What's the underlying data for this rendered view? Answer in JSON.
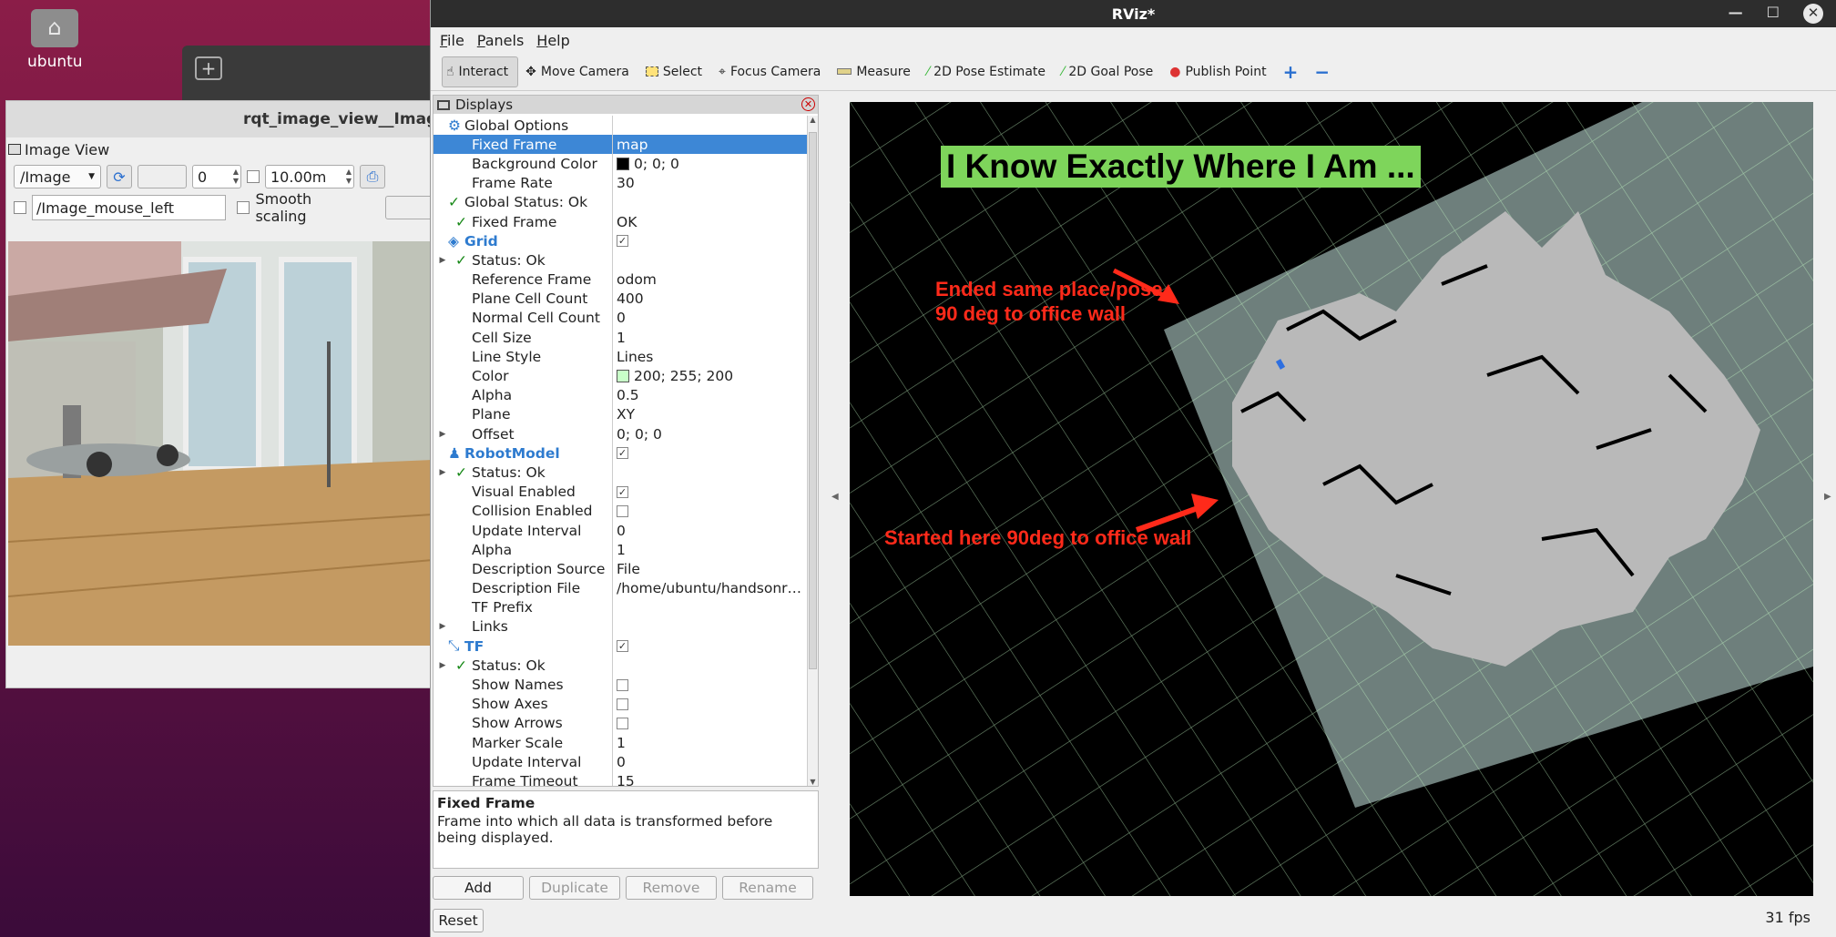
{
  "desktop": {
    "icon_label": "ubuntu"
  },
  "rqt": {
    "title": "rqt_image_view__ImageVi",
    "panel_title": "Image View",
    "topic": "/Image",
    "spin_value": "0",
    "max_range": "10.00m",
    "mouse_topic": "/Image_mouse_left",
    "smooth_scaling_label": "Smooth scaling"
  },
  "rviz": {
    "title": "RViz*",
    "menu": [
      "File",
      "Panels",
      "Help"
    ],
    "tools": {
      "interact": "Interact",
      "move_camera": "Move Camera",
      "select": "Select",
      "focus_camera": "Focus Camera",
      "measure": "Measure",
      "pose_estimate": "2D Pose Estimate",
      "goal_pose": "2D Goal Pose",
      "publish_point": "Publish Point"
    },
    "displays": {
      "title": "Displays",
      "rows": [
        {
          "name": "Global Options",
          "value": "",
          "indent": 0,
          "icon": "gear"
        },
        {
          "name": "Fixed Frame",
          "value": "map",
          "indent": 1,
          "selected": true
        },
        {
          "name": "Background Color",
          "value": "0; 0; 0",
          "indent": 1,
          "swatch": "#000000"
        },
        {
          "name": "Frame Rate",
          "value": "30",
          "indent": 1
        },
        {
          "name": "Global Status: Ok",
          "value": "",
          "indent": 0,
          "check": true
        },
        {
          "name": "Fixed Frame",
          "value": "OK",
          "indent": 1,
          "check": true
        },
        {
          "name": "Grid",
          "value": "",
          "indent": 0,
          "bold": true,
          "cb": true,
          "icon": "grid"
        },
        {
          "name": "Status: Ok",
          "value": "",
          "indent": 1,
          "check": true,
          "exp": true
        },
        {
          "name": "Reference Frame",
          "value": "odom",
          "indent": 1
        },
        {
          "name": "Plane Cell Count",
          "value": "400",
          "indent": 1
        },
        {
          "name": "Normal Cell Count",
          "value": "0",
          "indent": 1
        },
        {
          "name": "Cell Size",
          "value": "1",
          "indent": 1
        },
        {
          "name": "Line Style",
          "value": "Lines",
          "indent": 1
        },
        {
          "name": "Color",
          "value": "200; 255; 200",
          "indent": 1,
          "swatch": "#c8ffc8"
        },
        {
          "name": "Alpha",
          "value": "0.5",
          "indent": 1
        },
        {
          "name": "Plane",
          "value": "XY",
          "indent": 1
        },
        {
          "name": "Offset",
          "value": "0; 0; 0",
          "indent": 1,
          "exp": true
        },
        {
          "name": "RobotModel",
          "value": "",
          "indent": 0,
          "bold": true,
          "cb": true,
          "icon": "robot"
        },
        {
          "name": "Status: Ok",
          "value": "",
          "indent": 1,
          "check": true,
          "exp": true
        },
        {
          "name": "Visual Enabled",
          "value": "",
          "indent": 1,
          "cb": true
        },
        {
          "name": "Collision Enabled",
          "value": "",
          "indent": 1,
          "cbEmpty": true
        },
        {
          "name": "Update Interval",
          "value": "0",
          "indent": 1
        },
        {
          "name": "Alpha",
          "value": "1",
          "indent": 1
        },
        {
          "name": "Description Source",
          "value": "File",
          "indent": 1
        },
        {
          "name": "Description File",
          "value": "/home/ubuntu/handsonr…",
          "indent": 1
        },
        {
          "name": "TF Prefix",
          "value": "",
          "indent": 1
        },
        {
          "name": "Links",
          "value": "",
          "indent": 1,
          "exp": true
        },
        {
          "name": "TF",
          "value": "",
          "indent": 0,
          "bold": true,
          "cb": true,
          "icon": "tf"
        },
        {
          "name": "Status: Ok",
          "value": "",
          "indent": 1,
          "check": true,
          "exp": true
        },
        {
          "name": "Show Names",
          "value": "",
          "indent": 1,
          "cbEmpty": true
        },
        {
          "name": "Show Axes",
          "value": "",
          "indent": 1,
          "cbEmpty": true
        },
        {
          "name": "Show Arrows",
          "value": "",
          "indent": 1,
          "cbEmpty": true
        },
        {
          "name": "Marker Scale",
          "value": "1",
          "indent": 1
        },
        {
          "name": "Update Interval",
          "value": "0",
          "indent": 1
        },
        {
          "name": "Frame Timeout",
          "value": "15",
          "indent": 1
        }
      ]
    },
    "description": {
      "title": "Fixed Frame",
      "text": "Frame into which all data is transformed before being displayed."
    },
    "buttons": {
      "add": "Add",
      "duplicate": "Duplicate",
      "remove": "Remove",
      "rename": "Rename",
      "reset": "Reset"
    },
    "fps": "31 fps",
    "viewport": {
      "banner": "I Know Exactly Where I Am ...",
      "annotation_end_1": "Ended same place/pose",
      "annotation_end_2": "90 deg to office wall",
      "annotation_start": "Started here 90deg to office wall"
    }
  },
  "colors": {
    "selection": "#3d87d6",
    "annotation": "#ff2a1a",
    "banner_bg": "#7ed55b",
    "grid_line": "#c8ffc8"
  }
}
